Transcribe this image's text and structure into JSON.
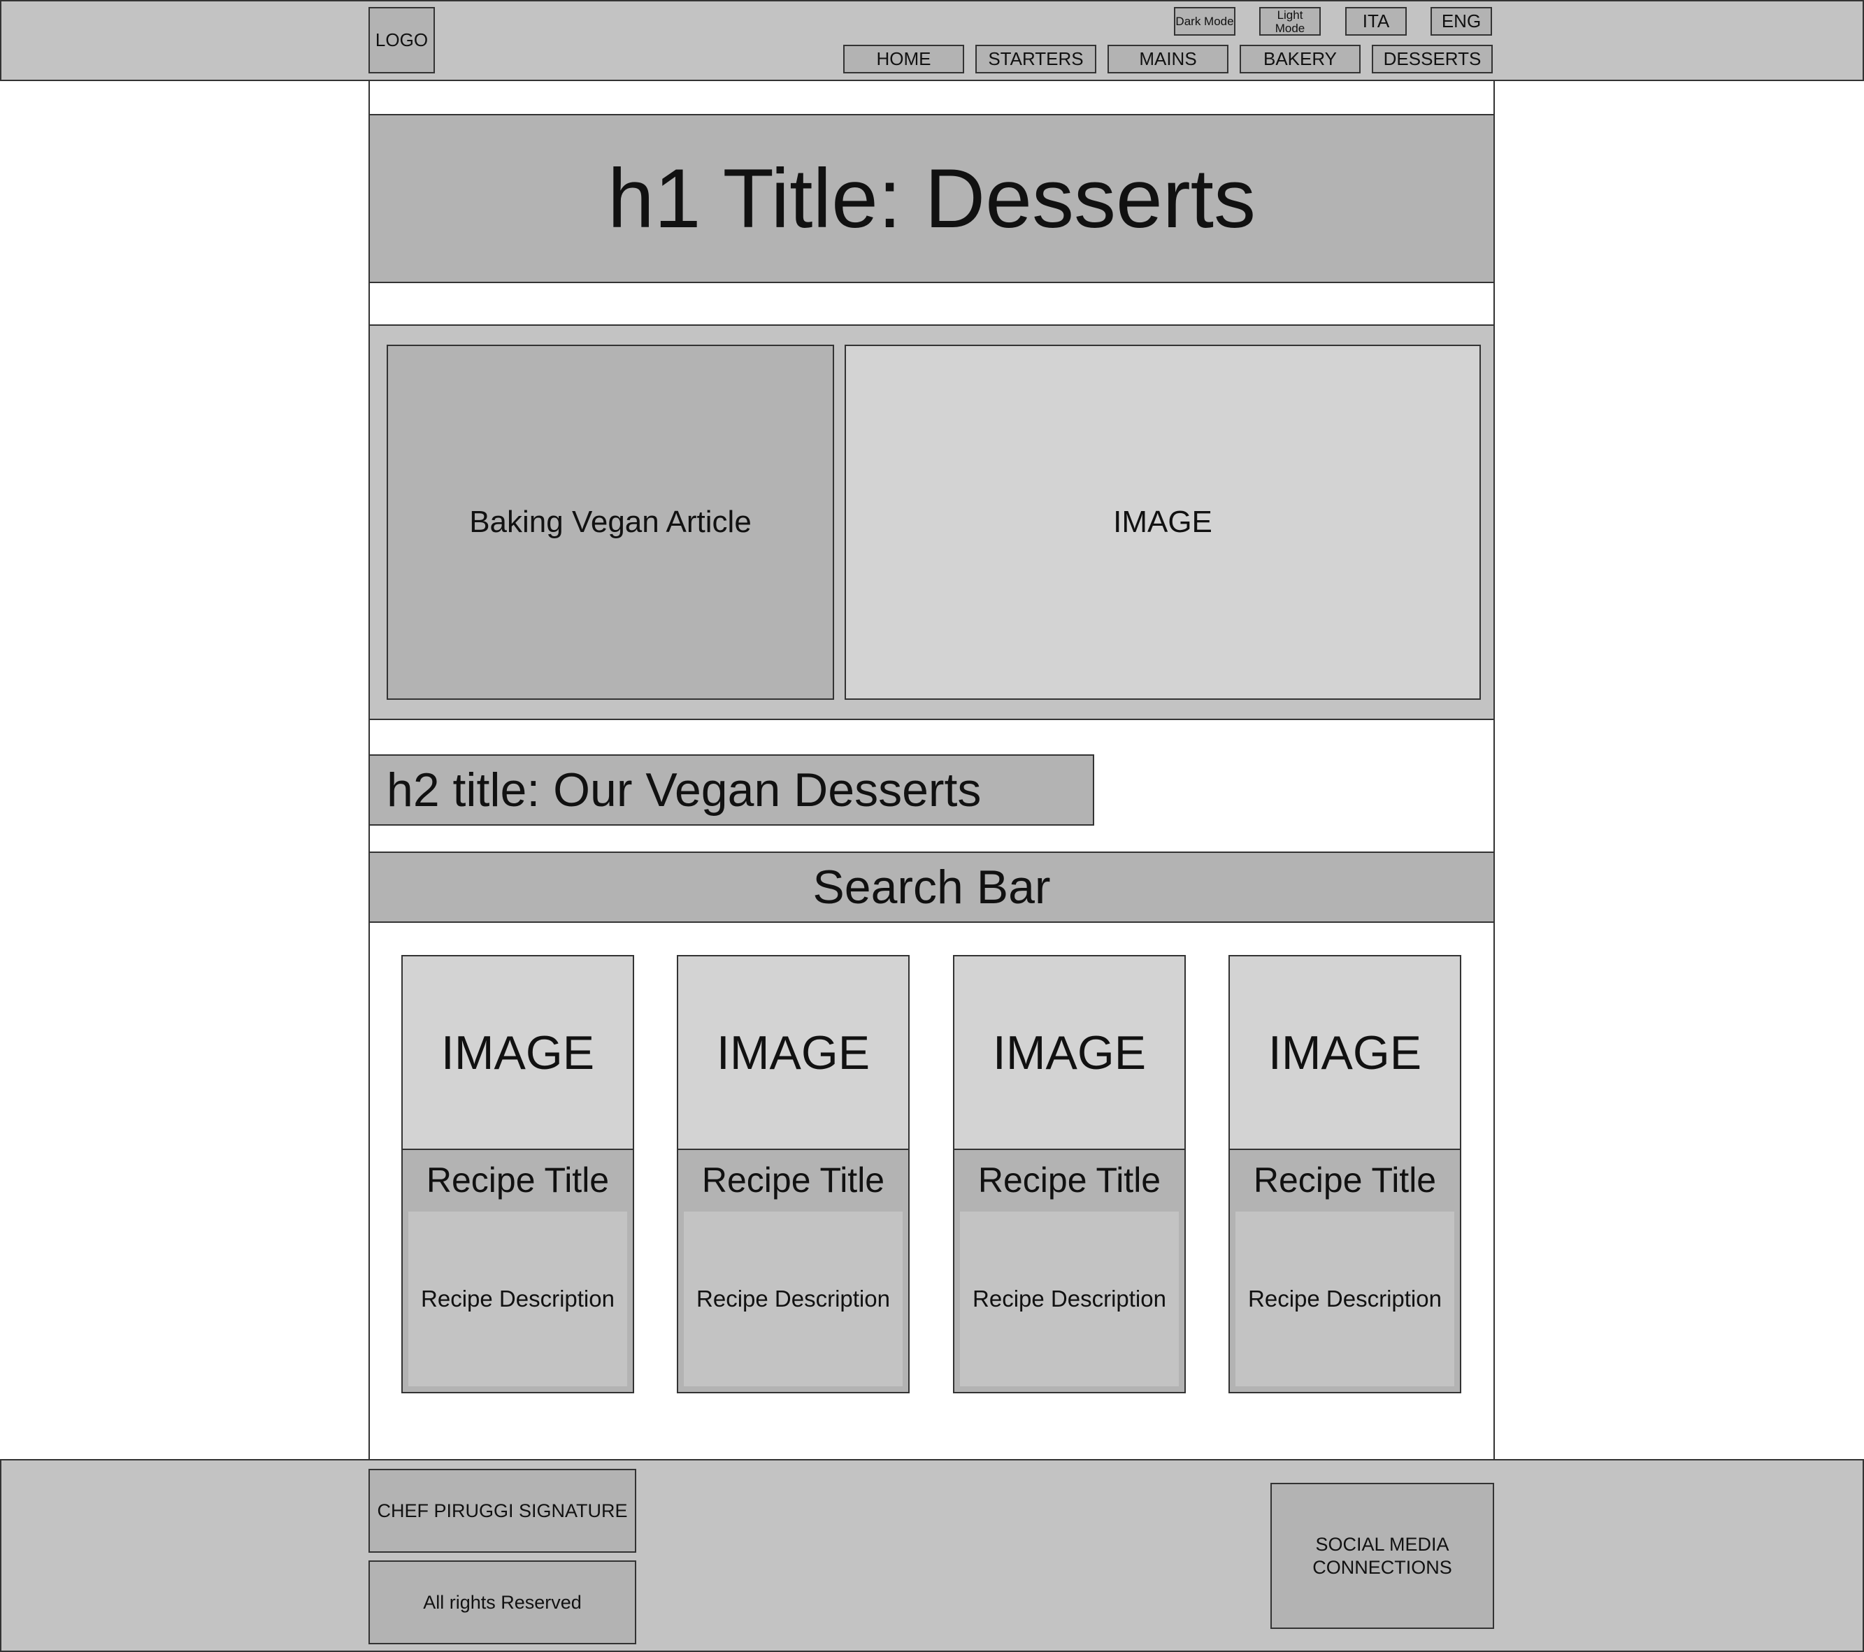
{
  "header": {
    "logo": "LOGO",
    "toggles": {
      "dark_mode": "Dark Mode",
      "light_mode": "Light Mode"
    },
    "languages": [
      "ITA",
      "ENG"
    ],
    "nav": [
      "HOME",
      "STARTERS",
      "MAINS",
      "BAKERY",
      "DESSERTS"
    ]
  },
  "main": {
    "h1_title": "h1 Title: Desserts",
    "feature": {
      "article": "Baking Vegan Article",
      "image": "IMAGE"
    },
    "h2_title": "h2 title: Our Vegan Desserts",
    "search_bar": "Search Bar",
    "cards": [
      {
        "image": "IMAGE",
        "title": "Recipe Title",
        "description": "Recipe Description"
      },
      {
        "image": "IMAGE",
        "title": "Recipe Title",
        "description": "Recipe Description"
      },
      {
        "image": "IMAGE",
        "title": "Recipe Title",
        "description": "Recipe Description"
      },
      {
        "image": "IMAGE",
        "title": "Recipe Title",
        "description": "Recipe Description"
      }
    ]
  },
  "footer": {
    "signature": "CHEF PIRUGGI SIGNATURE",
    "rights": "All rights Reserved",
    "social": "SOCIAL MEDIA CONNECTIONS"
  },
  "colors": {
    "header_bg": "#c3c3c3",
    "box_bg": "#b3b3b3",
    "image_placeholder": "#d3d3d3",
    "border": "#333333"
  }
}
